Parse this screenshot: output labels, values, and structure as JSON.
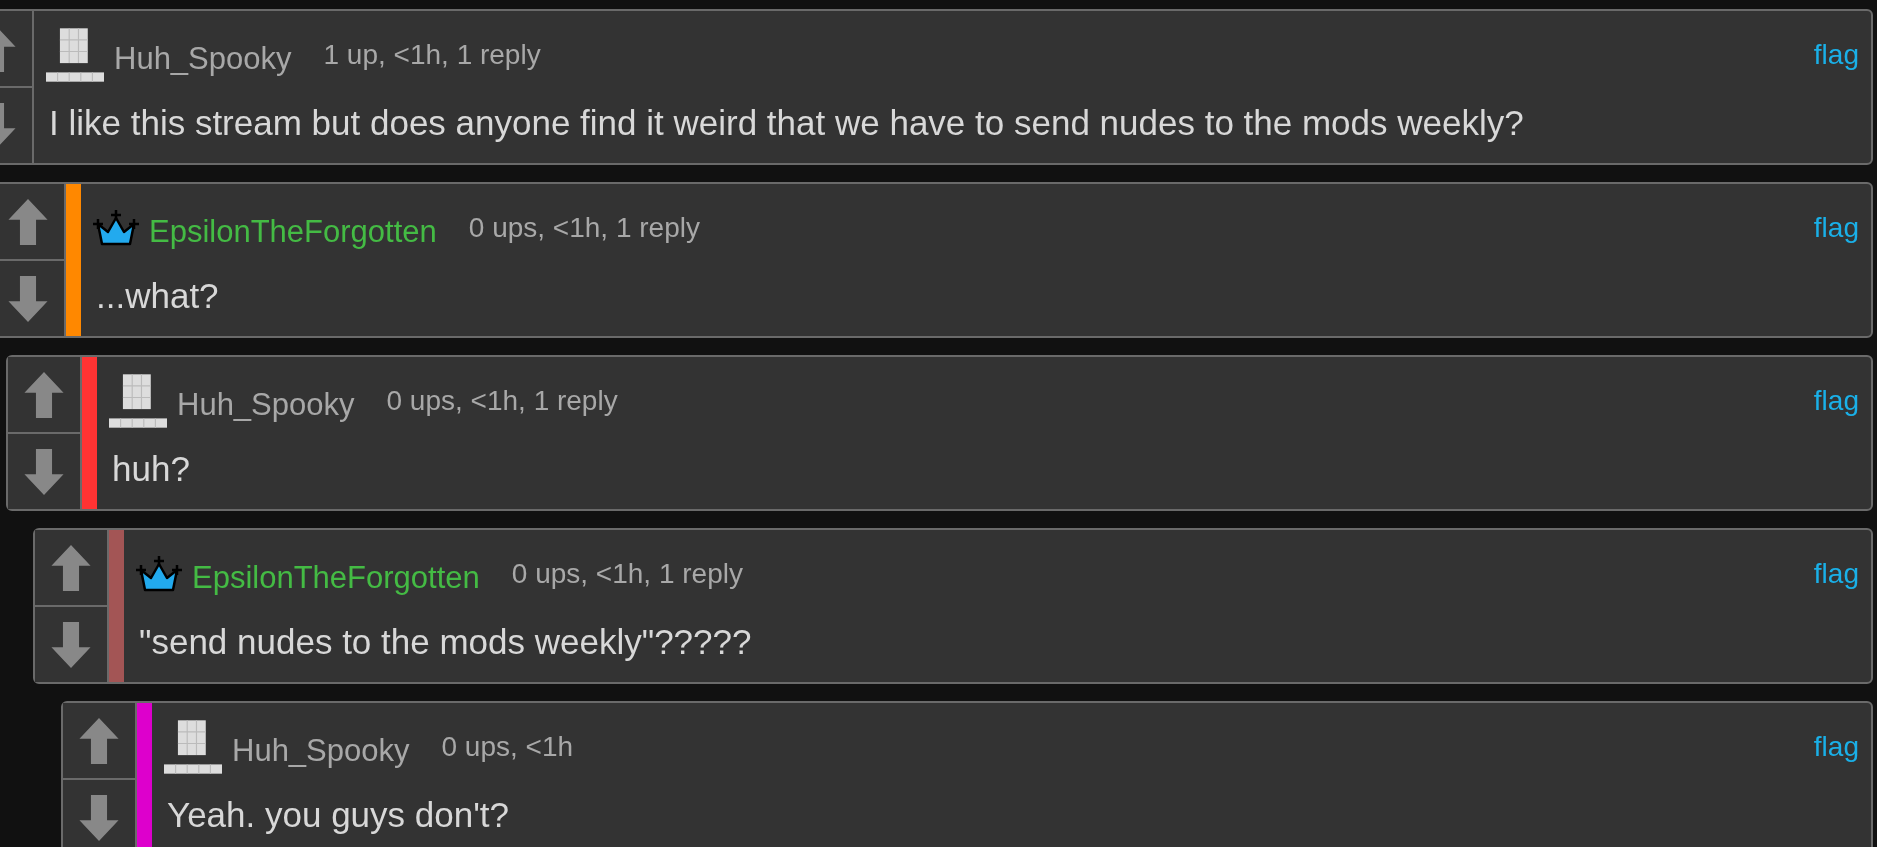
{
  "comments": [
    {
      "author": {
        "name": "Huh_Spooky",
        "kind": "user"
      },
      "meta": "1 up, <1h, 1 reply",
      "flag": "flag",
      "text": "I like this stream but does anyone find it weird that we have to send nudes to the mods weekly?",
      "children": [
        {
          "author": {
            "name": "EpsilonTheForgotten",
            "kind": "mod"
          },
          "meta": "0 ups, <1h, 1 reply",
          "flag": "flag",
          "text": "...what?",
          "color": "#ff8800",
          "children": [
            {
              "author": {
                "name": "Huh_Spooky",
                "kind": "user"
              },
              "meta": "0 ups, <1h, 1 reply",
              "flag": "flag",
              "text": "huh?",
              "color": "#ff3333",
              "children": [
                {
                  "author": {
                    "name": "EpsilonTheForgotten",
                    "kind": "mod"
                  },
                  "meta": "0 ups, <1h, 1 reply",
                  "flag": "flag",
                  "text": "\"send nudes to the mods weekly\"?????",
                  "color": "#a35555",
                  "children": [
                    {
                      "author": {
                        "name": "Huh_Spooky",
                        "kind": "user"
                      },
                      "meta": "0 ups, <1h",
                      "flag": "flag",
                      "text": "Yeah. you guys don't?",
                      "color": "#dd00cc"
                    }
                  ]
                }
              ]
            }
          ]
        }
      ]
    }
  ]
}
